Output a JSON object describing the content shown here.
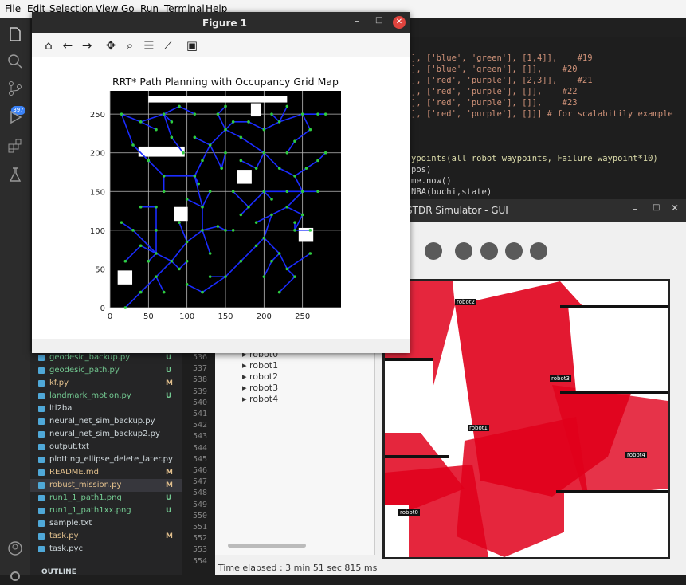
{
  "vscode": {
    "menu": [
      "File",
      "Edit",
      "Selection",
      "View",
      "Go",
      "Run",
      "Terminal",
      "Help"
    ],
    "activity_badge": "397",
    "files": [
      {
        "name": "geodesic_backup.py",
        "status": "U"
      },
      {
        "name": "geodesic_path.py",
        "status": "U"
      },
      {
        "name": "kf.py",
        "status": "M"
      },
      {
        "name": "landmark_motion.py",
        "status": "U"
      },
      {
        "name": "ltl2ba",
        "status": ""
      },
      {
        "name": "neural_net_sim_backup.py",
        "status": ""
      },
      {
        "name": "neural_net_sim_backup2.py",
        "status": ""
      },
      {
        "name": "output.txt",
        "status": ""
      },
      {
        "name": "plotting_ellipse_delete_later.py",
        "status": ""
      },
      {
        "name": "README.md",
        "status": "M"
      },
      {
        "name": "robust_mission.py",
        "status": "M"
      },
      {
        "name": "run1_1_path1.png",
        "status": "U"
      },
      {
        "name": "run1_1_path1xx.png",
        "status": "U"
      },
      {
        "name": "sample.txt",
        "status": ""
      },
      {
        "name": "task.py",
        "status": "M"
      },
      {
        "name": "task.pyc",
        "status": ""
      }
    ],
    "outline_label": "OUTLINE",
    "line_numbers": [
      "536",
      "537",
      "538",
      "539",
      "540",
      "541",
      "542",
      "543",
      "544",
      "545",
      "546",
      "547",
      "548",
      "549",
      "550",
      "551",
      "552",
      "553",
      "554"
    ],
    "code_lines": [
      "], ['blue', 'green'], [1,4]],    #19",
      "], ['blue', 'green'], []],    #20",
      "], ['red', 'purple'], [2,3]],    #21",
      "], ['red', 'purple'], []],    #22",
      "], ['red', 'purple'], []],    #23",
      "], ['red', 'purple'], []]] # for scalabitily example",
      "",
      "ypoints(all_robot_waypoints, Failure_waypoint*10)",
      "pos)",
      "me.now()",
      "NBA(buchi,state)"
    ]
  },
  "stdr": {
    "title": "STDR Simulator - GUI",
    "robots": [
      "robot0",
      "robot1",
      "robot2",
      "robot3",
      "robot4"
    ],
    "status": "Time elapsed : 3 min 51 sec 815 ms",
    "map_labels": [
      "robot2",
      "robot3",
      "robot1",
      "robot4",
      "robot0"
    ],
    "colors": {
      "laser": "#e0001b"
    }
  },
  "figure": {
    "window_title": "Figure 1",
    "tools": [
      "home-icon",
      "back-icon",
      "forward-icon",
      "pan-icon",
      "zoom-icon",
      "configure-icon",
      "edit-curve-icon",
      "save-icon"
    ]
  },
  "chart_data": {
    "type": "scatter",
    "title": "RRT* Path Planning with Occupancy Grid Map",
    "xlabel": "",
    "ylabel": "",
    "xlim": [
      0,
      300
    ],
    "ylim": [
      0,
      280
    ],
    "xticks": [
      0,
      50,
      100,
      150,
      200,
      250
    ],
    "yticks": [
      0,
      50,
      100,
      150,
      200,
      250
    ],
    "grid": true,
    "background": "#000000",
    "obstacles": [
      {
        "x": 50,
        "y": 265,
        "w": 180,
        "h": 8
      },
      {
        "x": 37,
        "y": 195,
        "w": 60,
        "h": 13
      },
      {
        "x": 183,
        "y": 247,
        "w": 13,
        "h": 17
      },
      {
        "x": 165,
        "y": 160,
        "w": 19,
        "h": 18
      },
      {
        "x": 83,
        "y": 112,
        "w": 18,
        "h": 18
      },
      {
        "x": 245,
        "y": 85,
        "w": 19,
        "h": 18
      },
      {
        "x": 10,
        "y": 30,
        "w": 19,
        "h": 18
      }
    ],
    "series": [
      {
        "points": [
          [
            20,
            0
          ],
          [
            40,
            20
          ],
          [
            60,
            40
          ],
          [
            80,
            60
          ],
          [
            100,
            85
          ],
          [
            120,
            100
          ],
          [
            140,
            105
          ],
          [
            150,
            100
          ],
          [
            120,
            130
          ],
          [
            110,
            170
          ],
          [
            130,
            210
          ],
          [
            150,
            230
          ],
          [
            170,
            220
          ],
          [
            200,
            200
          ],
          [
            220,
            180
          ],
          [
            240,
            170
          ],
          [
            250,
            150
          ],
          [
            230,
            130
          ],
          [
            210,
            120
          ],
          [
            200,
            90
          ],
          [
            220,
            70
          ],
          [
            230,
            50
          ],
          [
            240,
            40
          ],
          [
            210,
            60
          ],
          [
            190,
            80
          ],
          [
            170,
            60
          ],
          [
            150,
            40
          ],
          [
            120,
            20
          ],
          [
            90,
            50
          ],
          [
            60,
            70
          ],
          [
            30,
            100
          ],
          [
            15,
            110
          ],
          [
            60,
            100
          ],
          [
            90,
            110
          ],
          [
            100,
            140
          ],
          [
            70,
            170
          ],
          [
            50,
            190
          ],
          [
            30,
            210
          ],
          [
            15,
            250
          ],
          [
            40,
            240
          ],
          [
            70,
            250
          ],
          [
            90,
            260
          ],
          [
            110,
            250
          ],
          [
            140,
            250
          ],
          [
            160,
            240
          ],
          [
            180,
            240
          ],
          [
            200,
            230
          ],
          [
            220,
            240
          ],
          [
            250,
            250
          ],
          [
            270,
            250
          ],
          [
            280,
            250
          ],
          [
            260,
            230
          ],
          [
            240,
            215
          ],
          [
            230,
            200
          ],
          [
            270,
            190
          ],
          [
            255,
            180
          ],
          [
            250,
            120
          ],
          [
            230,
            150
          ],
          [
            200,
            150
          ],
          [
            180,
            130
          ],
          [
            160,
            150
          ],
          [
            145,
            180
          ],
          [
            130,
            150
          ],
          [
            115,
            160
          ],
          [
            80,
            220
          ],
          [
            95,
            200
          ],
          [
            60,
            130
          ],
          [
            40,
            80
          ],
          [
            100,
            60
          ],
          [
            130,
            70
          ],
          [
            160,
            100
          ],
          [
            190,
            110
          ],
          [
            210,
            140
          ],
          [
            240,
            100
          ],
          [
            260,
            70
          ],
          [
            270,
            150
          ],
          [
            280,
            200
          ],
          [
            190,
            180
          ],
          [
            170,
            190
          ],
          [
            150,
            200
          ],
          [
            120,
            190
          ],
          [
            110,
            220
          ],
          [
            80,
            240
          ],
          [
            60,
            230
          ],
          [
            170,
            120
          ],
          [
            200,
            40
          ],
          [
            220,
            20
          ],
          [
            240,
            110
          ],
          [
            260,
            100
          ],
          [
            130,
            40
          ],
          [
            100,
            30
          ],
          [
            70,
            20
          ],
          [
            50,
            60
          ],
          [
            20,
            60
          ],
          [
            40,
            130
          ],
          [
            70,
            150
          ],
          [
            150,
            260
          ],
          [
            210,
            250
          ],
          [
            230,
            260
          ]
        ]
      }
    ]
  }
}
